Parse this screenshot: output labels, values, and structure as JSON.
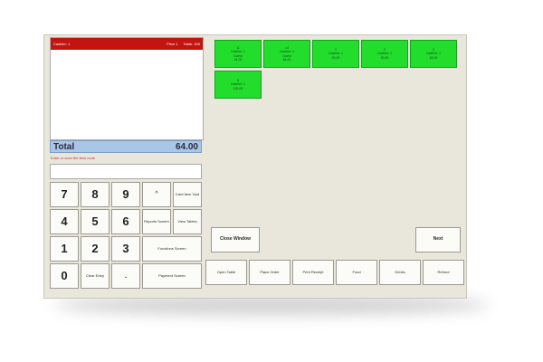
{
  "receipt": {
    "cashier": "Cashier: 1",
    "price_level": "Price 1",
    "table": "Table: 100"
  },
  "total": {
    "label": "Total",
    "amount": "64.00"
  },
  "hint": "Enter or scan the item code",
  "keypad": {
    "digits": [
      "7",
      "8",
      "9",
      "4",
      "5",
      "6",
      "1",
      "2",
      "3",
      "0"
    ],
    "dot": ".",
    "clear_entry": "Clear Entry",
    "caret": "^"
  },
  "functions": {
    "card_item": "Card Item Void",
    "reports": "Reports Screen",
    "view_tables": "View Tables",
    "functions_screen": "Functions Screen",
    "payment_screen": "Payment Screen"
  },
  "bottom_bar": {
    "open_table": "Open Table",
    "place_order": "Place Order",
    "print_receipt": "Print Receipt",
    "food": "Food",
    "drinks": "Drinks",
    "refund": "Refund"
  },
  "close_window": "Close Window",
  "next": "Next",
  "tables": [
    {
      "lines": [
        "11",
        "Cashier: 1",
        "Guest",
        "34.00"
      ]
    },
    {
      "lines": [
        "14",
        "Cashier: 1",
        "Guest",
        "64.00"
      ]
    },
    {
      "lines": [
        "1",
        "Cashier: 1",
        "20.00"
      ]
    },
    {
      "lines": [
        "2",
        "Cashier: 1",
        "30.00"
      ]
    },
    {
      "lines": [
        "3",
        "Cashier: 1",
        "18.00"
      ]
    },
    {
      "lines": [
        "8",
        "Cashier: 1",
        "100.00"
      ]
    }
  ],
  "colors": {
    "header_red": "#c4140f",
    "total_blue": "#a9c6e6",
    "table_green": "#22dd2c",
    "background": "#e9e6dc"
  }
}
